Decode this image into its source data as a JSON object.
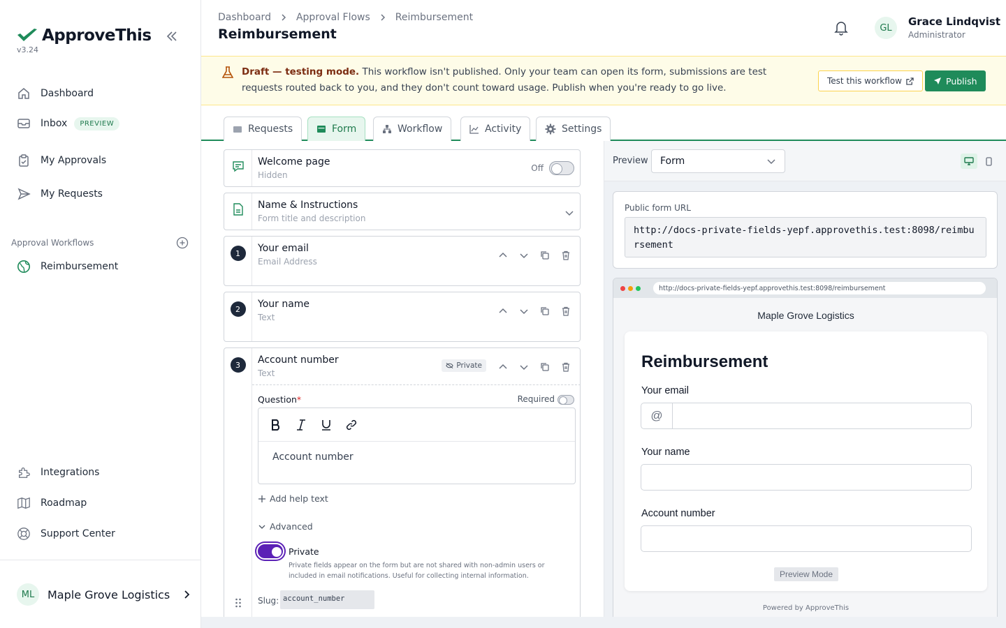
{
  "sidebar": {
    "brand": "ApproveThis",
    "version": "v3.24",
    "nav": [
      {
        "label": "Dashboard"
      },
      {
        "label": "Inbox",
        "badge": "PREVIEW"
      },
      {
        "label": "My Approvals"
      },
      {
        "label": "My Requests"
      }
    ],
    "workflows_label": "Approval Workflows",
    "workflows": [
      {
        "label": "Reimbursement"
      }
    ],
    "footer_nav": [
      {
        "label": "Integrations"
      },
      {
        "label": "Roadmap"
      },
      {
        "label": "Support Center"
      }
    ],
    "org": {
      "initials": "ML",
      "name": "Maple Grove Logistics"
    }
  },
  "header": {
    "breadcrumb": [
      "Dashboard",
      "Approval Flows",
      "Reimbursement"
    ],
    "title": "Reimbursement",
    "user": {
      "initials": "GL",
      "name": "Grace Lindqvist",
      "role": "Administrator"
    }
  },
  "banner": {
    "bold": "Draft — testing mode.",
    "text": " This workflow isn't published. Only your team can open its form, submissions are test requests routed back to you, and they don't count toward usage. Publish when you're ready to go live.",
    "test_label": "Test this workflow",
    "publish_label": "Publish"
  },
  "tabs": [
    {
      "label": "Requests"
    },
    {
      "label": "Form",
      "active": true
    },
    {
      "label": "Workflow"
    },
    {
      "label": "Activity"
    },
    {
      "label": "Settings"
    }
  ],
  "editor": {
    "welcome": {
      "title": "Welcome page",
      "sub": "Hidden",
      "toggle_label": "Off"
    },
    "name_instr": {
      "title": "Name & Instructions",
      "sub": "Form title and description"
    },
    "fields": [
      {
        "num": "1",
        "title": "Your email",
        "type": "Email Address"
      },
      {
        "num": "2",
        "title": "Your name",
        "type": "Text"
      },
      {
        "num": "3",
        "title": "Account number",
        "type": "Text",
        "tag": "Private"
      }
    ],
    "question_label": "Question",
    "required_mark": "*",
    "required_label": "Required",
    "question_value": "Account number",
    "add_help": "Add help text",
    "advanced": "Advanced",
    "private_label": "Private",
    "private_help": "Private fields appear on the form but are not shared with non-admin users or included in email notifications. Useful for collecting internal information.",
    "slug_label": "Slug:",
    "slug_value": "account_number"
  },
  "preview": {
    "label": "Preview",
    "select_value": "Form",
    "url_label": "Public form URL",
    "url": "http://docs-private-fields-yepf.approvethis.test:8098/reimbursement",
    "browser_url": "http://docs-private-fields-yepf.approvethis.test:8098/reimbursement",
    "org_title": "Maple Grove Logistics",
    "form_title": "Reimbursement",
    "fields": [
      "Your email",
      "Your name",
      "Account number"
    ],
    "at_symbol": "@",
    "mode": "Preview Mode",
    "powered": "Powered by ApproveThis"
  },
  "colors": {
    "accent": "#1f8b5a",
    "toggle_on": "#5b21b6",
    "banner_bg": "#fefce8"
  }
}
